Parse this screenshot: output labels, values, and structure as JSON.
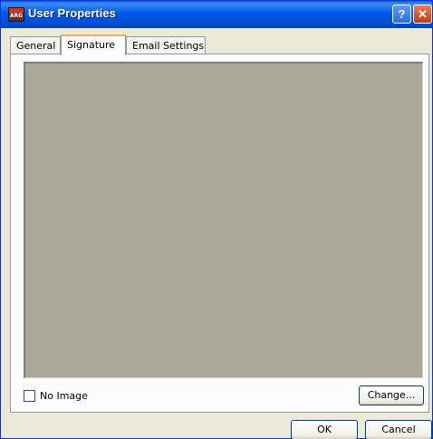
{
  "window": {
    "title": "User Properties",
    "app_icon_text": "ARG",
    "help_glyph": "?",
    "close_glyph": "✕"
  },
  "tabs": [
    {
      "label": "General",
      "active": false
    },
    {
      "label": "Signature",
      "active": true
    },
    {
      "label": "Email Settings",
      "active": false
    }
  ],
  "signature": {
    "no_image_label": "No Image",
    "no_image_checked": false,
    "change_label": "Change..."
  },
  "footer": {
    "ok_label": "OK",
    "cancel_label": "Cancel"
  },
  "colors": {
    "titlebar": "#0058e6",
    "signature_area": "#aca899",
    "dialog_bg": "#ece9d8"
  }
}
